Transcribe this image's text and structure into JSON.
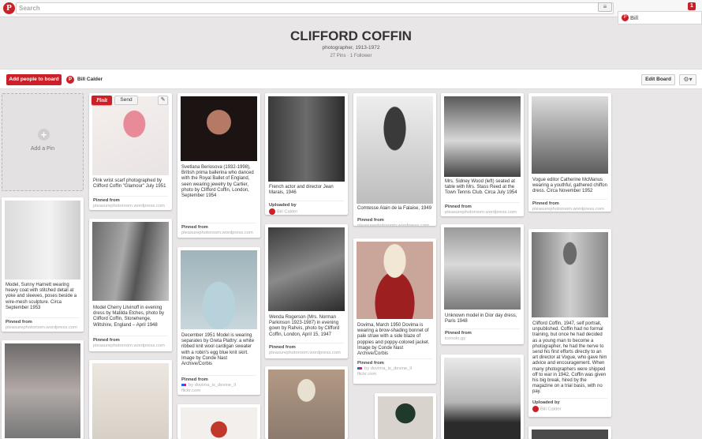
{
  "header": {
    "search_placeholder": "Search",
    "menu_glyph": "≡",
    "notif_count": "1",
    "user": "Bill"
  },
  "board": {
    "title": "CLIFFORD COFFIN",
    "subtitle": "photographer, 1913-1972",
    "pins": "27 Pins",
    "followers": "1 Follower",
    "sep": "·"
  },
  "actions": {
    "add_people": "Add people to board",
    "owner": "Bill Calder",
    "edit": "Edit Board",
    "gear": "⚙▾"
  },
  "add_pin": {
    "label": "Add a Pin",
    "plus": "+"
  },
  "hover": {
    "pinit": "Pinit",
    "send": "Send",
    "edit_glyph": "✎"
  },
  "pins": [
    {
      "desc": "Pink wrist scarf photographed by Clifford Coffin \"Glamour\" July 1951",
      "lbl": "Pinned from",
      "src": "pleasurephotoroom.wordpress.com"
    },
    {
      "desc": "Svetlana Beriosova (1932-1998), British prima ballerina who danced with the Royal Ballet of England, seen wearing jewelry by Cartier, photo by Clifford Coffin, London, September 1954",
      "lbl": "Pinned from",
      "src": "pleasurephotoroom.wordpress.com"
    },
    {
      "desc": "French actor and director Jean Marais, 1946",
      "lbl": "Uploaded by",
      "src": "Bill Calder"
    },
    {
      "desc": "Comtesse Alain de la Falaise, 1949",
      "lbl": "Pinned from",
      "src": "pleasurephotoroom.wordpress.com"
    },
    {
      "desc": "Mrs. Sidney Wood (left) seated at table with Mrs. Stass Reed at the Town Tennis Club. Circa July 1954",
      "lbl": "Pinned from",
      "src": "pleasurephotoroom.wordpress.com"
    },
    {
      "desc": "Vogue editor Catherine McManus wearing a youthful, gathered chiffon dress. Circa November 1952",
      "lbl": "Pinned from",
      "src": "pleasurephotoroom.wordpress.com"
    },
    {
      "desc": "Model, Sunny Harnett wearing heavy coat with stitched detail at yoke and sleeves, poses beside a wire-mesh sculpture. Circa September 1953",
      "lbl": "Pinned from",
      "src": "pleasurephotoroom.wordpress.com"
    },
    {
      "desc": "Model Cherry Litvinoff in evening dress by Matilda Etches, photo by Clifford Coffin, Stonehenge, Wiltshire, England – April 1948",
      "lbl": "Pinned from",
      "src": "pleasurephotoroom.wordpress.com"
    },
    {
      "desc": "December 1951 Model is wearing separates by Greta Plattry: a white ribbed knit wool cardigan sweater with a robin's egg blue knit skirt. Image by Conde Nast Archive/Corbis",
      "lbl": "Pinned from",
      "src": "flickr.com",
      "via": "by dovima_is_devine_ll"
    },
    {
      "desc": "Wenda Rogerson (Mrs. Norman Parkinson 1923-1987) in evening gown by Rahvis, photo by Clifford Coffin, London, April 15, 1947",
      "lbl": "Pinned from",
      "src": "pleasurephotoroom.wordpress.com"
    },
    {
      "desc": "Dovima, March 1950 Dovima is wearing a brow-shading bonnet of pale straw with a side blaze of poppies and poppy-colored jacket. Image by Conde Nast Archive/Corbis",
      "lbl": "Pinned from",
      "src": "flickr.com",
      "via": "by dovima_is_devine_ll"
    },
    {
      "desc": "Unknown model in Dior day dress, Paris 1948",
      "lbl": "Pinned from",
      "src": "iconolo.gy"
    },
    {
      "desc": "Clifford Coffin, 1947, self portrait, unpublished. Coffin had no formal training, but once he had decided as a young man to become a photographer, he had the nerve to send his first efforts directly to an art director at Vogue, who gave him advice and encouragement. When many photographers were shipped off to war in 1942, Coffin was given his big break, hired by the magazine on a trial basis, with no pay.",
      "lbl": "Uploaded by",
      "src": "Bill Calder"
    }
  ]
}
